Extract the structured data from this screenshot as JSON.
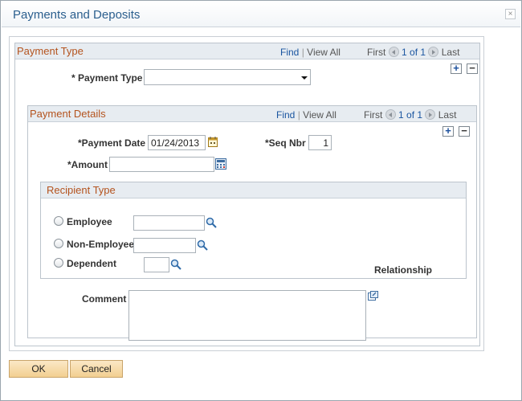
{
  "dialog": {
    "title": "Payments and Deposits",
    "close_glyph": "×"
  },
  "payment_type_grid": {
    "title": "Payment Type",
    "find": "Find",
    "view_all": "View All",
    "first": "First",
    "count": "1 of 1",
    "last": "Last",
    "field_label": "* Payment Type",
    "field_value": ""
  },
  "payment_details_grid": {
    "title": "Payment Details",
    "find": "Find",
    "view_all": "View All",
    "first": "First",
    "count": "1 of 1",
    "last": "Last",
    "payment_date_label": "*Payment Date",
    "payment_date_value": "01/24/2013",
    "seq_nbr_label": "*Seq Nbr",
    "seq_nbr_value": "1",
    "amount_label": "*Amount",
    "amount_value": ""
  },
  "recipient_type": {
    "title": "Recipient Type",
    "employee_label": "Employee",
    "non_employee_label": "Non-Employee",
    "dependent_label": "Dependent",
    "relationship_label": "Relationship"
  },
  "comment": {
    "label": "Comment",
    "value": ""
  },
  "buttons": {
    "ok": "OK",
    "cancel": "Cancel"
  },
  "symbols": {
    "sep": "|",
    "add": "+",
    "remove": "−"
  },
  "icons": [
    "close-icon",
    "prev-icon",
    "next-icon",
    "add-row-icon",
    "delete-row-icon",
    "calendar-icon",
    "calculator-icon",
    "lookup-icon",
    "expand-icon",
    "radio-icon",
    "dropdown-caret-icon"
  ],
  "colors": {
    "title_blue": "#2b5f8e",
    "section_orange": "#b4531e",
    "link_blue": "#1a55a0",
    "button_fill": "#f2cf91"
  }
}
